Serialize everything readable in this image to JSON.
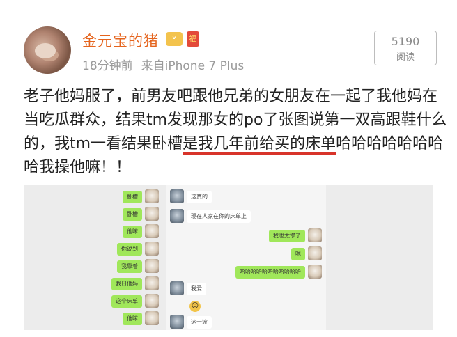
{
  "post": {
    "username": "金元宝的猪",
    "vip_badge": "ᵛ",
    "red_badge": "福",
    "time": "18分钟前",
    "source": "来自iPhone 7 Plus",
    "read_count": "5190",
    "read_label": "阅读",
    "text_1": "老子他妈服了，前男友吧跟他兄弟的女朋友在一起了我他妈在当吃瓜群众，结果tm发现那女的po了张图说第一双高跟鞋什么的，我tm一看结果卧槽",
    "text_highlight_1": "是我几年前给",
    "text_highlight_2": "买的床单",
    "text_2": "哈哈哈哈哈哈哈哈我操他嘛！！"
  },
  "chat_left": {
    "m1": "卧槽",
    "m2": "卧槽",
    "m3": "他嘛",
    "m4": "你说到",
    "m5": "我靠着",
    "m6": "我日他妈",
    "m7": "这个床单",
    "m8": "他嘛"
  },
  "chat_right": {
    "r1": "这真的",
    "r2": "现在人家在你的床单上",
    "r3": "我也太惨了",
    "r4": "嗯",
    "r5": "哈哈哈哈哈哈哈哈哈哈哈",
    "r6": "我爱",
    "r7": "这一波"
  }
}
